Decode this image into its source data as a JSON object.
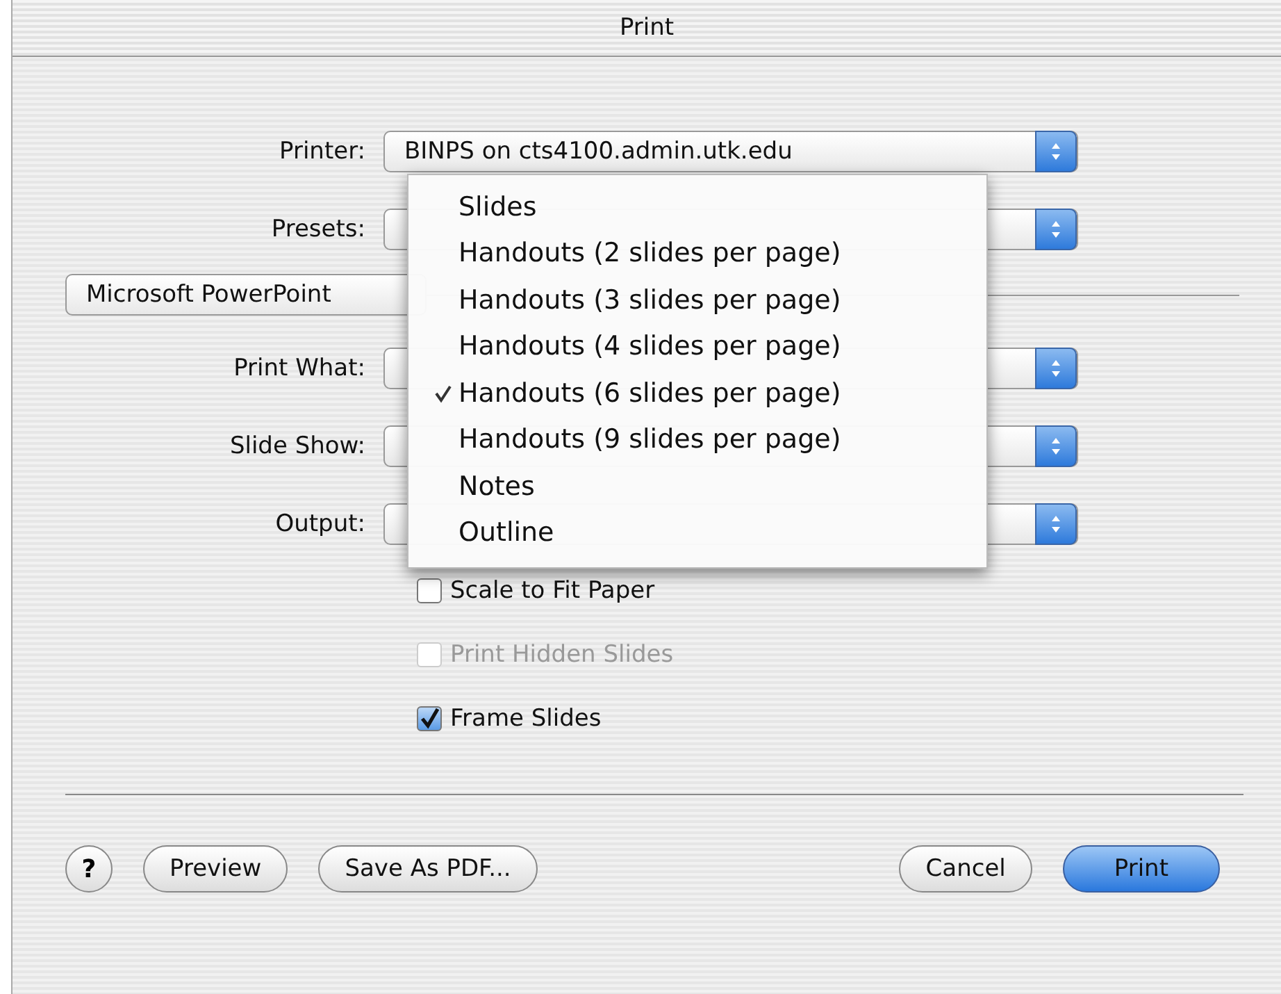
{
  "window": {
    "title": "Print"
  },
  "top_fields": [
    {
      "label": "Printer:",
      "value": "BINPS on cts4100.admin.utk.edu"
    },
    {
      "label": "Presets:"
    }
  ],
  "panel_selector": {
    "value": "Microsoft PowerPoint"
  },
  "fields": [
    {
      "label": "Print What:"
    },
    {
      "label": "Slide Show:"
    },
    {
      "label": "Output:"
    }
  ],
  "menu": {
    "items": [
      {
        "label": "Slides",
        "selected": false
      },
      {
        "label": "Handouts (2 slides per page)",
        "selected": false
      },
      {
        "label": "Handouts (3 slides per page)",
        "selected": false
      },
      {
        "label": "Handouts (4 slides per page)",
        "selected": false
      },
      {
        "label": "Handouts (6 slides per page)",
        "selected": true
      },
      {
        "label": "Handouts (9 slides per page)",
        "selected": false
      },
      {
        "label": "Notes",
        "selected": false
      },
      {
        "label": "Outline",
        "selected": false
      }
    ]
  },
  "checkboxes": [
    {
      "label": "Scale to Fit Paper",
      "checked": false,
      "disabled": false
    },
    {
      "label": "Print Hidden Slides",
      "checked": false,
      "disabled": true
    },
    {
      "label": "Frame Slides",
      "checked": true,
      "disabled": false
    }
  ],
  "buttons": {
    "help": "?",
    "left": [
      "Preview",
      "Save As PDF..."
    ],
    "cancel": "Cancel",
    "default": "Print"
  }
}
